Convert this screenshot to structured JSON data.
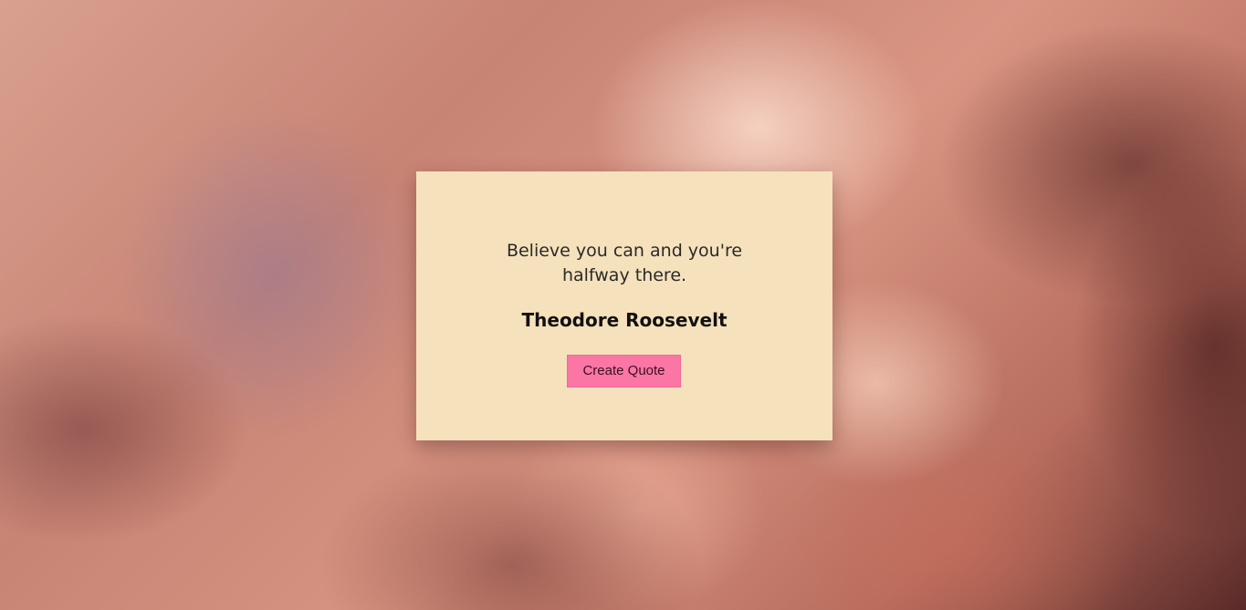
{
  "quote_card": {
    "quote_text": "Believe you can and you're halfway there.",
    "author": "Theodore Roosevelt",
    "button_label": "Create Quote"
  },
  "colors": {
    "card_background": "#f5e1bb",
    "button_background": "#fb76a5"
  }
}
